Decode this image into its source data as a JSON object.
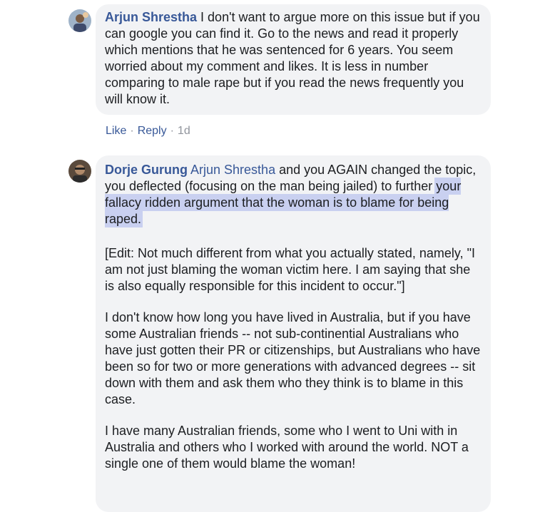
{
  "comments": [
    {
      "author": "Arjun Shrestha",
      "text": "I don't want to argue more on this issue but if you can google you can find it. Go to the news and read it properly which mentions that he was sentenced for 6 years. You seem worried about my comment and likes. It is less in number comparing to male rape but if you read the news frequently you will know it.",
      "actions": {
        "like": "Like",
        "reply": "Reply",
        "separator": "·",
        "time": "1d"
      }
    },
    {
      "author": "Dorje Gurung",
      "mention": "Arjun Shrestha",
      "text_before_highlight": "and you AGAIN changed the topic, you deflected (focusing on the man being jailed) to further ",
      "highlighted": "your fallacy ridden argument that the woman is to blame for being raped.",
      "paragraphs": [
        "[Edit: Not much different from what you actually stated, namely, \"I am not just blaming the woman victim here. I am saying that she is also equally responsible for this incident to occur.\"]",
        "I don't know how long you have lived in Australia, but if you have some Australian friends -- not sub-continential Australians who have just gotten their PR or citizenships, but Australians who have been so for two or more generations with advanced degrees -- sit down with them and ask them who they think is to blame in this case.",
        "I have many Australian friends, some who I went to Uni with in Australia and others who I worked with around the world. NOT a single one of them would blame the woman!"
      ]
    }
  ]
}
